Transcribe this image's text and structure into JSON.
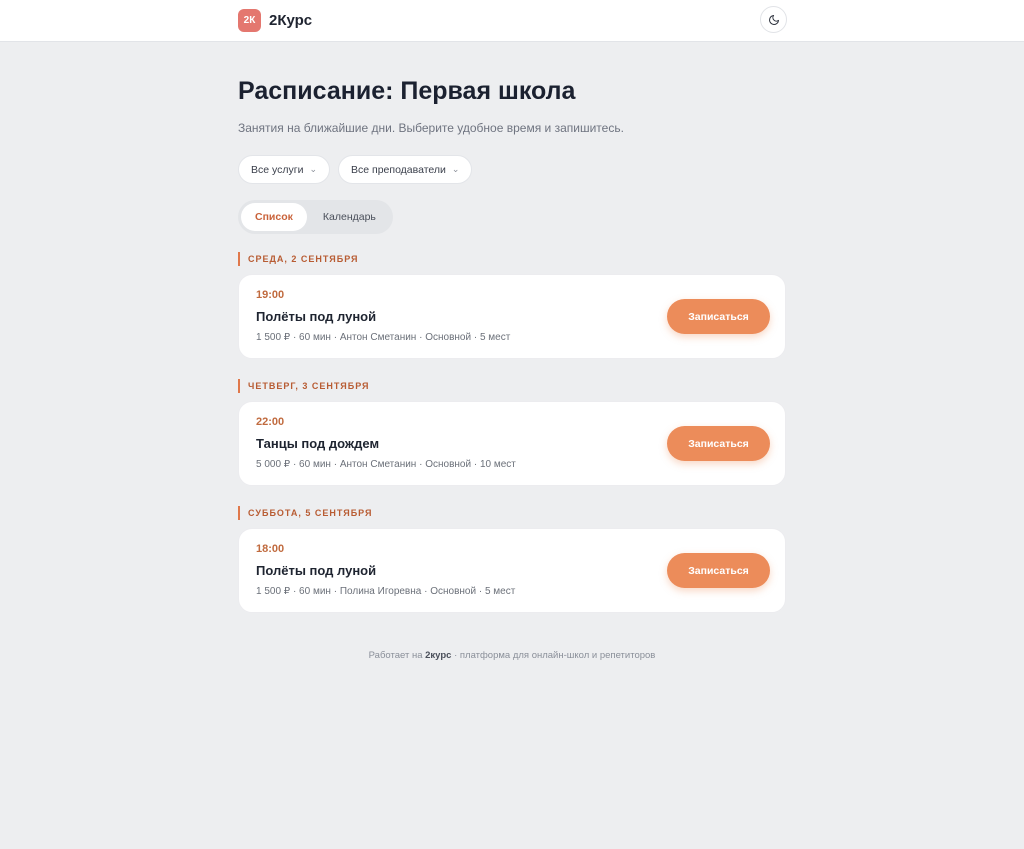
{
  "header": {
    "logo_mark": "2К",
    "logo_name": "2Курс",
    "theme_toggle_icon": "moon-icon"
  },
  "page": {
    "title": "Расписание: Первая школа",
    "subtitle": "Занятия на ближайшие дни. Выберите удобное время и запишитесь."
  },
  "filters": {
    "services": "Все услуги",
    "teachers": "Все преподаватели"
  },
  "view_tabs": {
    "list": "Список",
    "calendar": "Календарь",
    "active": "list"
  },
  "days": [
    {
      "label": "СРЕДА, 2 СЕНТЯБРЯ",
      "lessons": [
        {
          "time": "19:00",
          "title": "Полёты под луной",
          "meta": "1 500 ₽ · 60 мин · Антон Сметанин · Основной · 5 мест",
          "button": "Записаться"
        }
      ]
    },
    {
      "label": "ЧЕТВЕРГ, 3 СЕНТЯБРЯ",
      "lessons": [
        {
          "time": "22:00",
          "title": "Танцы под дождем",
          "meta": "5 000 ₽ · 60 мин · Антон Сметанин · Основной · 10 мест",
          "button": "Записаться"
        }
      ]
    },
    {
      "label": "СУББОТА, 5 СЕНТЯБРЯ",
      "lessons": [
        {
          "time": "18:00",
          "title": "Полёты под луной",
          "meta": "1 500 ₽ · 60 мин · Полина Игоревна · Основной · 5 мест",
          "button": "Записаться"
        }
      ]
    }
  ],
  "footer": {
    "prefix": "Работает на",
    "brand": "2курс",
    "suffix": "· платформа для онлайн-школ и репетиторов"
  },
  "colors": {
    "accent": "#ec8c5a",
    "accent_text": "#c06a3e",
    "logo_bg": "#e4776f",
    "page_bg": "#edeef0"
  }
}
